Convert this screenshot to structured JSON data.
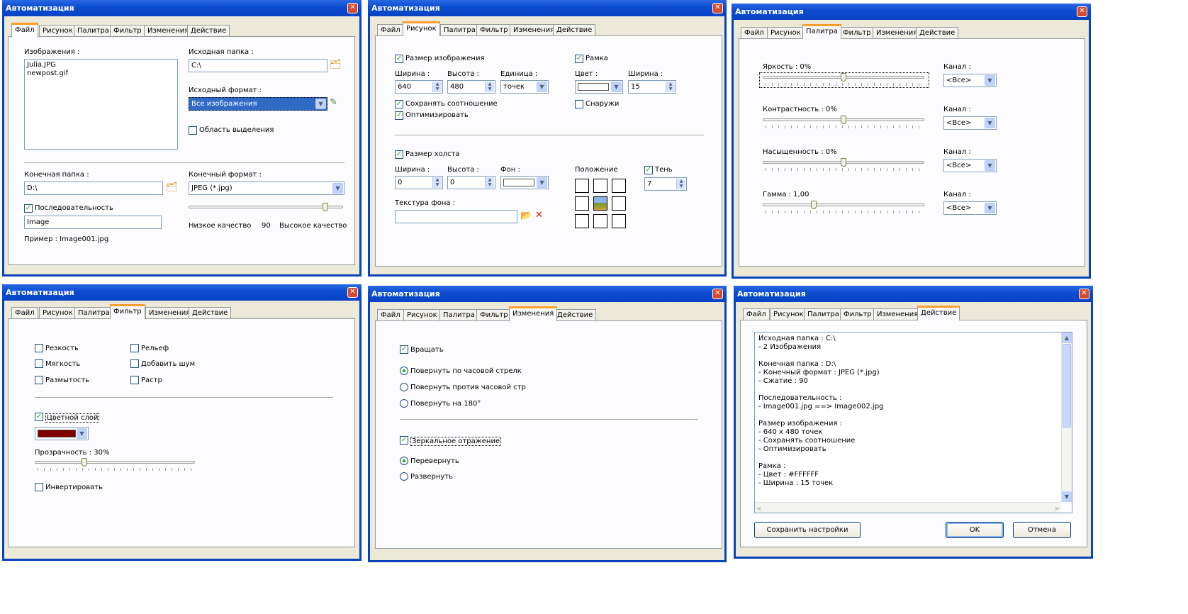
{
  "window_title": "Автоматизация",
  "close_glyph": "✕",
  "tabs": [
    "Файл",
    "Рисунок",
    "Палитра",
    "Фильтр",
    "Изменения",
    "Действие"
  ],
  "file": {
    "images_label": "Изображения :",
    "images": [
      "Julia.JPG",
      "newpost.gif"
    ],
    "src_folder_label": "Исходная папка :",
    "src_folder": "C:\\",
    "src_format_label": "Исходный формат :",
    "src_format": "Все изображения",
    "selection_area": "Область выделения",
    "dest_folder_label": "Конечная папка :",
    "dest_folder": "D:\\",
    "dest_format_label": "Конечный формат :",
    "dest_format": "JPEG (*.jpg)",
    "sequence": "Последовательность",
    "sequence_value": "Image",
    "example": "Пример : Image001.jpg",
    "low_quality": "Низкое качество",
    "quality_value": "90",
    "high_quality": "Высокое качество",
    "quality_fraction": 0.9
  },
  "picture": {
    "image_size": "Размер изображения",
    "width_label": "Ширина :",
    "width": "640",
    "height_label": "Высота :",
    "height": "480",
    "unit_label": "Единица :",
    "unit": "точек",
    "frame": "Рамка",
    "color_label": "Цвет :",
    "frame_width_label": "Ширина :",
    "frame_width": "15",
    "outside": "Снаружи",
    "keep_ratio": "Сохранять соотношение",
    "optimize": "Оптимизировать",
    "canvas_size": "Размер холста",
    "canvas_width_label": "Ширина :",
    "canvas_width": "0",
    "canvas_height_label": "Высота :",
    "canvas_height": "0",
    "bg_label": "Фон :",
    "position_label": "Положение",
    "shadow": "Тень",
    "shadow_value": "7",
    "texture_label": "Текстура фона :"
  },
  "palette": {
    "channel_label": "Канал :",
    "channel_value": "<Все>",
    "rows": [
      {
        "label": "Яркость : 0%",
        "level": 0.5
      },
      {
        "label": "Контрастность : 0%",
        "level": 0.5
      },
      {
        "label": "Насыщенность : 0%",
        "level": 0.5
      },
      {
        "label": "Гамма : 1,00",
        "level": 0.3
      }
    ]
  },
  "filter": {
    "sharpness": "Резкость",
    "softness": "Мягкость",
    "blur": "Размытость",
    "relief": "Рельеф",
    "add_noise": "Добавить шум",
    "raster": "Растр",
    "color_layer": "Цветной слой",
    "layer_color": "#800000",
    "transparency": "Прозрачность : 30%",
    "transparency_level": 0.3,
    "invert": "Инвертировать"
  },
  "changes": {
    "rotate": "Вращать",
    "rot_cw": "Повернуть по часовой стрелк",
    "rot_ccw": "Повернуть против часовой стр",
    "rot_180": "Повернуть на 180°",
    "mirror": "Зеркальное отражение",
    "flip": "Перевернуть",
    "turn": "Развернуть"
  },
  "action": {
    "lines": [
      "Исходная папка : C:\\",
      "- 2 Изображения",
      "",
      "Конечная папка : D:\\",
      "- Конечный формат : JPEG (*.jpg)",
      "- Сжатие : 90",
      "",
      "Последовательность :",
      "- Image001.jpg ==> Image002.jpg",
      "",
      "Размер изображения :",
      "- 640 x 480 точек",
      "- Сохранять соотношение",
      "- Оптимизировать",
      "",
      "Рамка :",
      "- Цвет : #FFFFFF",
      "- Ширина : 15 точек"
    ],
    "save_settings": "Сохранить настройки",
    "ok": "OK",
    "cancel": "Отмена"
  }
}
